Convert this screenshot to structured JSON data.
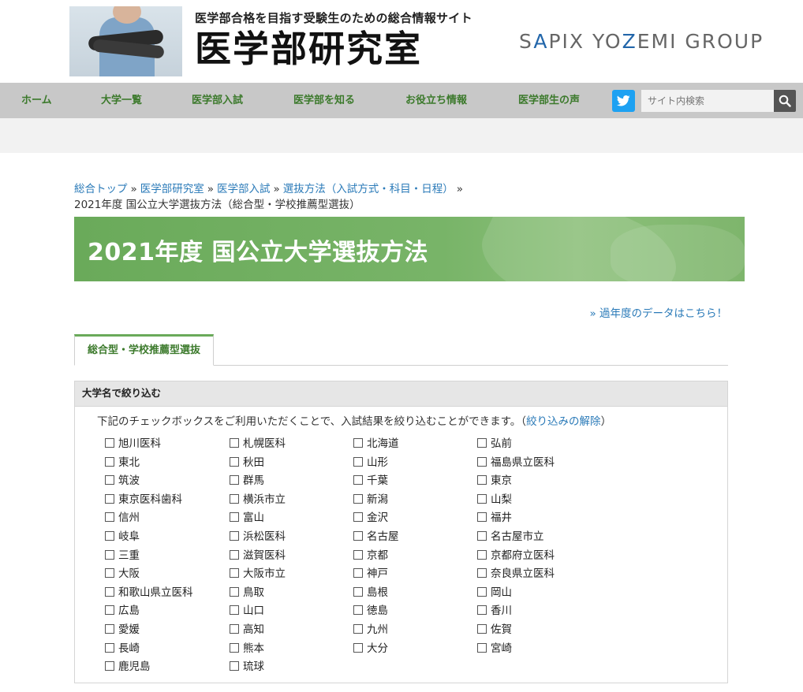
{
  "header": {
    "tagline": "医学部合格を目指す受験生のための総合情報サイト",
    "site_title": "医学部研究室",
    "group_pre": "S",
    "group_a": "A",
    "group_mid": "PIX YO",
    "group_z": "Z",
    "group_post": "EMI GROUP"
  },
  "nav": {
    "items": [
      "ホーム",
      "大学一覧",
      "医学部入試",
      "医学部を知る",
      "お役立ち情報",
      "医学部生の声"
    ],
    "search_placeholder": "サイト内検索"
  },
  "breadcrumb": {
    "links": [
      "総合トップ",
      "医学部研究室",
      "医学部入試",
      "選抜方法（入試方式・科目・日程）"
    ],
    "separator": "»",
    "current": "2021年度 国公立大学選抜方法（総合型・学校推薦型選抜）"
  },
  "banner": {
    "title": "2021年度 国公立大学選抜方法"
  },
  "past_link": "» 過年度のデータはこちら！",
  "tab": {
    "label": "総合型・学校推薦型選抜"
  },
  "filter": {
    "heading": "大学名で絞り込む",
    "description": "下記のチェックボックスをご利用いただくことで、入試結果を絞り込むことができます。（",
    "clear_link": "絞り込みの解除",
    "close_paren": "）",
    "universities": [
      "旭川医科",
      "札幌医科",
      "北海道",
      "弘前",
      "東北",
      "秋田",
      "山形",
      "福島県立医科",
      "筑波",
      "群馬",
      "千葉",
      "東京",
      "東京医科歯科",
      "横浜市立",
      "新潟",
      "山梨",
      "信州",
      "富山",
      "金沢",
      "福井",
      "岐阜",
      "浜松医科",
      "名古屋",
      "名古屋市立",
      "三重",
      "滋賀医科",
      "京都",
      "京都府立医科",
      "大阪",
      "大阪市立",
      "神戸",
      "奈良県立医科",
      "和歌山県立医科",
      "鳥取",
      "島根",
      "岡山",
      "広島",
      "山口",
      "徳島",
      "香川",
      "愛媛",
      "高知",
      "九州",
      "佐賀",
      "長崎",
      "熊本",
      "大分",
      "宮崎",
      "鹿児島",
      "琉球"
    ]
  }
}
